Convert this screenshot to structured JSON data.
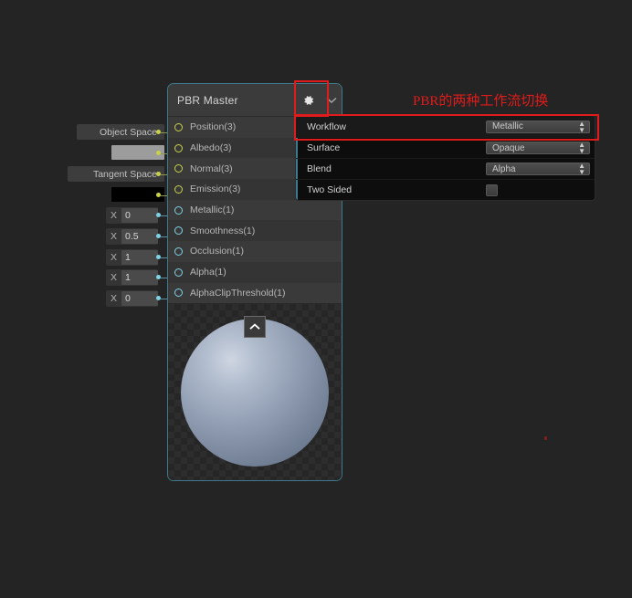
{
  "app": {
    "canvas_bg": "#242424",
    "accent_border": "#3d7b8c",
    "annotation_color": "#e01b1b"
  },
  "node": {
    "title": "PBR Master",
    "gear_icon": "gear-icon",
    "chevron_icon": "chevron-down-icon",
    "collapse_icon": "chevron-up-icon",
    "slots": [
      {
        "label": "Position(3)",
        "type": "vector",
        "input": {
          "kind": "enum",
          "value": "Object Space"
        }
      },
      {
        "label": "Albedo(3)",
        "type": "vector",
        "input": {
          "kind": "color",
          "value": "#9c9c9c"
        }
      },
      {
        "label": "Normal(3)",
        "type": "vector",
        "input": {
          "kind": "enum",
          "value": "Tangent Space"
        }
      },
      {
        "label": "Emission(3)",
        "type": "vector",
        "input": {
          "kind": "color",
          "value": "#000000"
        }
      },
      {
        "label": "Metallic(1)",
        "type": "float",
        "input": {
          "kind": "number",
          "axis": "X",
          "value": "0"
        }
      },
      {
        "label": "Smoothness(1)",
        "type": "float",
        "input": {
          "kind": "number",
          "axis": "X",
          "value": "0.5"
        }
      },
      {
        "label": "Occlusion(1)",
        "type": "float",
        "input": {
          "kind": "number",
          "axis": "X",
          "value": "1"
        }
      },
      {
        "label": "Alpha(1)",
        "type": "float",
        "input": {
          "kind": "number",
          "axis": "X",
          "value": "1"
        }
      },
      {
        "label": "AlphaClipThreshold(1)",
        "type": "float",
        "input": {
          "kind": "number",
          "axis": "X",
          "value": "0"
        }
      }
    ]
  },
  "settings_popup": {
    "rows": [
      {
        "label": "Workflow",
        "control": "enum",
        "value": "Metallic",
        "highlighted": true
      },
      {
        "label": "Surface",
        "control": "enum",
        "value": "Opaque",
        "highlighted": false
      },
      {
        "label": "Blend",
        "control": "enum",
        "value": "Alpha",
        "highlighted": false
      },
      {
        "label": "Two Sided",
        "control": "checkbox",
        "value": "",
        "highlighted": false
      }
    ]
  },
  "annotations": {
    "note_text": "PBR的两种工作流切换"
  }
}
